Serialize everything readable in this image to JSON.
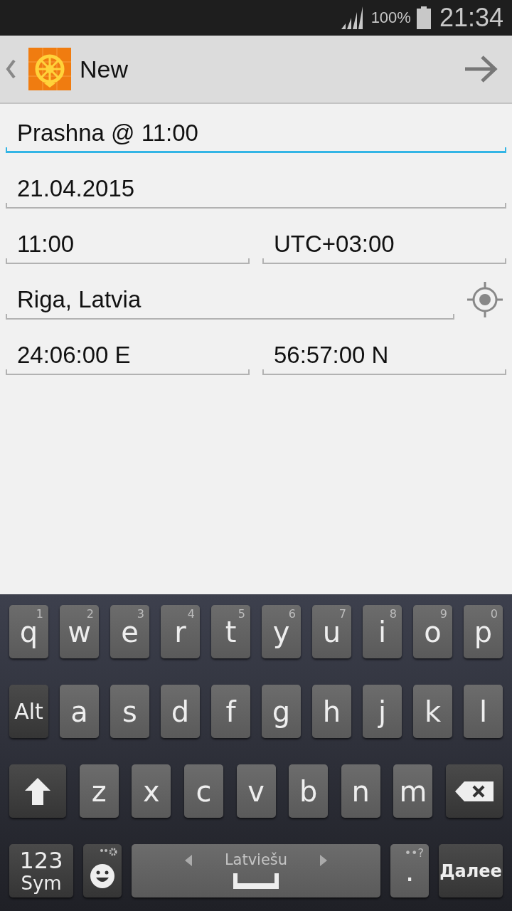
{
  "status_bar": {
    "battery": "100%",
    "time": "21:34"
  },
  "app_bar": {
    "title": "New"
  },
  "form": {
    "rows": [
      {
        "fields": [
          {
            "value": "Prashna @ 11:00",
            "focused": true
          }
        ],
        "locate_button": false
      },
      {
        "fields": [
          {
            "value": "21.04.2015",
            "focused": false
          }
        ],
        "locate_button": false
      },
      {
        "fields": [
          {
            "value": "11:00",
            "focused": false
          },
          {
            "value": "UTC+03:00",
            "focused": false
          }
        ],
        "locate_button": false
      },
      {
        "fields": [
          {
            "value": "Riga, Latvia",
            "focused": false
          }
        ],
        "locate_button": true
      },
      {
        "fields": [
          {
            "value": "24:06:00 E",
            "focused": false
          },
          {
            "value": "56:57:00 N",
            "focused": false
          }
        ],
        "locate_button": false
      }
    ]
  },
  "keyboard": {
    "rows": [
      {
        "keys": [
          {
            "kind": "letter",
            "label": "q",
            "hint": "1"
          },
          {
            "kind": "letter",
            "label": "w",
            "hint": "2"
          },
          {
            "kind": "letter",
            "label": "e",
            "hint": "3"
          },
          {
            "kind": "letter",
            "label": "r",
            "hint": "4"
          },
          {
            "kind": "letter",
            "label": "t",
            "hint": "5"
          },
          {
            "kind": "letter",
            "label": "y",
            "hint": "6"
          },
          {
            "kind": "letter",
            "label": "u",
            "hint": "7"
          },
          {
            "kind": "letter",
            "label": "i",
            "hint": "8"
          },
          {
            "kind": "letter",
            "label": "o",
            "hint": "9"
          },
          {
            "kind": "letter",
            "label": "p",
            "hint": "0"
          }
        ]
      },
      {
        "keys": [
          {
            "kind": "alt",
            "label": "Alt"
          },
          {
            "kind": "letter",
            "label": "a"
          },
          {
            "kind": "letter",
            "label": "s"
          },
          {
            "kind": "letter",
            "label": "d"
          },
          {
            "kind": "letter",
            "label": "f"
          },
          {
            "kind": "letter",
            "label": "g"
          },
          {
            "kind": "letter",
            "label": "h"
          },
          {
            "kind": "letter",
            "label": "j"
          },
          {
            "kind": "letter",
            "label": "k"
          },
          {
            "kind": "letter",
            "label": "l"
          }
        ]
      },
      {
        "keys": [
          {
            "kind": "shift"
          },
          {
            "kind": "letter",
            "label": "z"
          },
          {
            "kind": "letter",
            "label": "x"
          },
          {
            "kind": "letter",
            "label": "c"
          },
          {
            "kind": "letter",
            "label": "v"
          },
          {
            "kind": "letter",
            "label": "b"
          },
          {
            "kind": "letter",
            "label": "n"
          },
          {
            "kind": "letter",
            "label": "m"
          },
          {
            "kind": "backspace"
          }
        ]
      },
      {
        "keys": [
          {
            "kind": "sym",
            "label": "123",
            "sublabel": "Sym"
          },
          {
            "kind": "emoji"
          },
          {
            "kind": "space",
            "label": "Latviešu"
          },
          {
            "kind": "period",
            "label": ".",
            "hint": "••?"
          },
          {
            "kind": "action",
            "label": "Далее"
          }
        ]
      }
    ]
  }
}
